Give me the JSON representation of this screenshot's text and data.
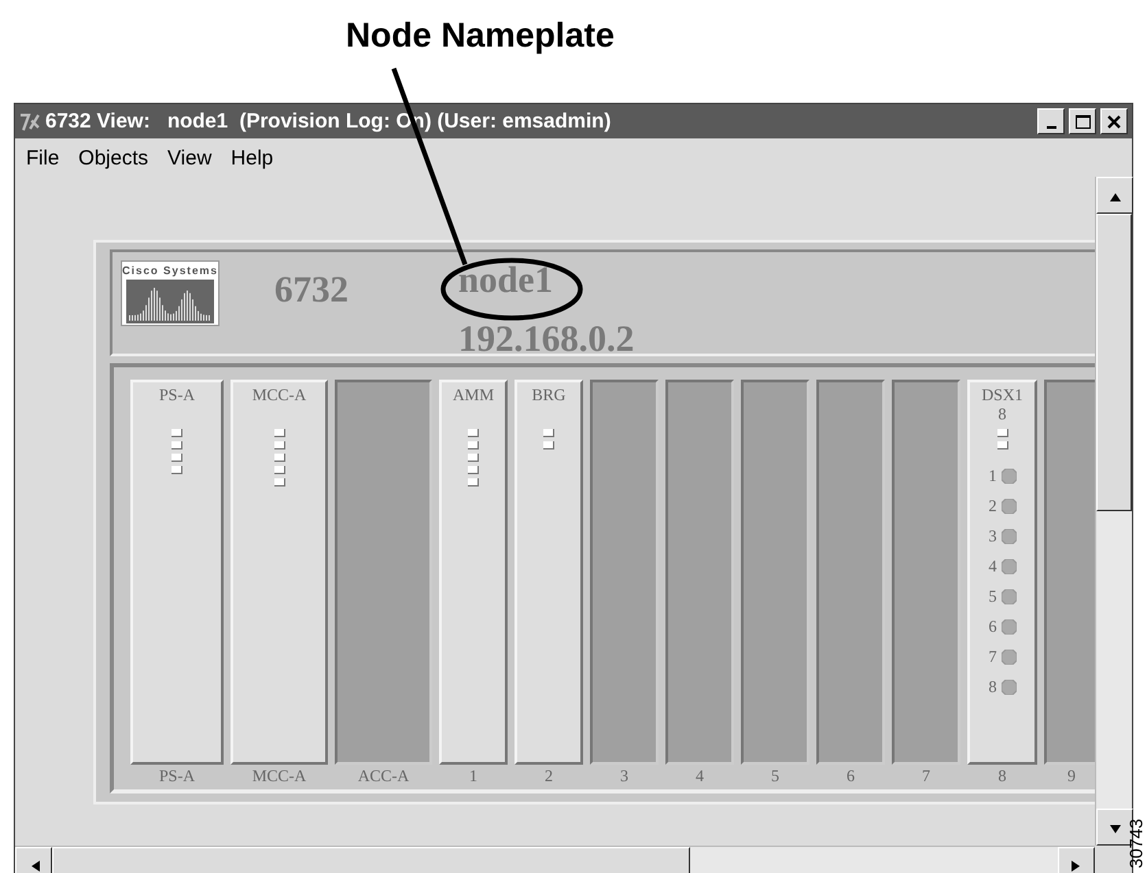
{
  "callout": {
    "label": "Node Nameplate"
  },
  "window": {
    "title": "6732 View:   node1  (Provision Log: On) (User: emsadmin)"
  },
  "menu": [
    "File",
    "Objects",
    "View",
    "Help"
  ],
  "nameplate": {
    "logo": "Cisco Systems",
    "model": "6732",
    "node": "node1",
    "address": "192.168.0.2"
  },
  "slots": [
    {
      "kind": "card",
      "name": "PS-A",
      "label": "PS-A",
      "leds": [
        {
          "on": false
        },
        {
          "on": false
        },
        {
          "on": false
        },
        {
          "on": false
        }
      ]
    },
    {
      "kind": "card",
      "name": "MCC-A",
      "label": "MCC-A",
      "leds": [
        {
          "on": false
        },
        {
          "on": false
        },
        {
          "on": false
        },
        {
          "on": false
        },
        {
          "on": false
        }
      ]
    },
    {
      "kind": "empty",
      "label": "ACC-A"
    },
    {
      "kind": "card",
      "name": "AMM",
      "label": "1",
      "leds": [
        {
          "on": false
        },
        {
          "on": false
        },
        {
          "on": false
        },
        {
          "on": false
        },
        {
          "on": false
        }
      ]
    },
    {
      "kind": "card",
      "name": "BRG",
      "label": "2",
      "leds": [
        {
          "on": false
        },
        {
          "on": false
        }
      ]
    },
    {
      "kind": "empty",
      "label": "3"
    },
    {
      "kind": "empty",
      "label": "4"
    },
    {
      "kind": "empty",
      "label": "5"
    },
    {
      "kind": "empty",
      "label": "6"
    },
    {
      "kind": "empty",
      "label": "7"
    },
    {
      "kind": "card",
      "name": "DSX1",
      "sub": "8",
      "label": "8",
      "leds": [
        {
          "on": false
        },
        {
          "on": false
        }
      ],
      "ports": [
        "1",
        "2",
        "3",
        "4",
        "5",
        "6",
        "7",
        "8"
      ]
    },
    {
      "kind": "empty",
      "label": "9"
    }
  ],
  "figure_id": "30743"
}
